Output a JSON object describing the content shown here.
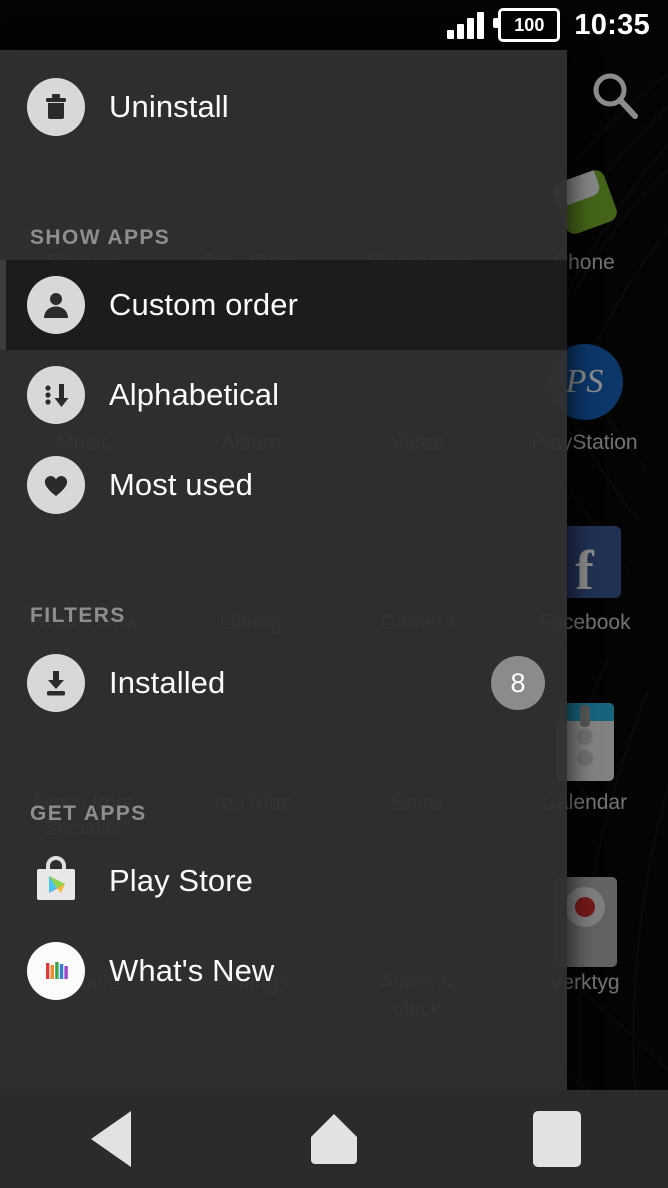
{
  "status_bar": {
    "signal_icon": "signal-bars-icon",
    "battery_level": "100",
    "time": "10:35"
  },
  "app_drawer": {
    "title": "Custom order",
    "search_icon": "search-icon",
    "apps": [
      {
        "label": "Chrome",
        "icon": "chrome-icon"
      },
      {
        "label": "Play Store",
        "icon": "play-store-icon"
      },
      {
        "label": "Messaging",
        "icon": "messaging-icon"
      },
      {
        "label": "Phone",
        "icon": "phone-icon"
      },
      {
        "label": "Music",
        "icon": "music-icon"
      },
      {
        "label": "Album",
        "icon": "album-icon"
      },
      {
        "label": "Video",
        "icon": "video-icon"
      },
      {
        "label": "PlayStation",
        "icon": "playstation-icon"
      },
      {
        "label": "What's New",
        "icon": "whats-new-icon"
      },
      {
        "label": "Lifelog",
        "icon": "lifelog-icon"
      },
      {
        "label": "Camera",
        "icon": "camera-icon"
      },
      {
        "label": "Facebook",
        "icon": "facebook-icon"
      },
      {
        "label": "News from\nSocialife",
        "icon": "socialife-icon"
      },
      {
        "label": "YouTube",
        "icon": "youtube-icon"
      },
      {
        "label": "Email",
        "icon": "email-icon"
      },
      {
        "label": "Calendar",
        "icon": "calendar-icon"
      },
      {
        "label": "Contacts",
        "icon": "contacts-icon"
      },
      {
        "label": "Settings",
        "icon": "settings-icon"
      },
      {
        "label": "Alarm &\nclock",
        "icon": "alarm-clock-icon"
      },
      {
        "label": "Verktyg",
        "icon": "verktyg-icon"
      }
    ]
  },
  "nav_drawer": {
    "uninstall": {
      "label": "Uninstall",
      "icon": "trash-icon"
    },
    "sections": [
      {
        "header": "SHOW APPS",
        "items": [
          {
            "label": "Custom order",
            "icon": "person-icon",
            "selected": true
          },
          {
            "label": "Alphabetical",
            "icon": "sort-alphabetical-icon",
            "selected": false
          },
          {
            "label": "Most used",
            "icon": "heart-icon",
            "selected": false
          }
        ]
      },
      {
        "header": "FILTERS",
        "items": [
          {
            "label": "Installed",
            "icon": "download-icon",
            "selected": false,
            "badge": "8"
          }
        ]
      },
      {
        "header": "GET APPS",
        "items": [
          {
            "label": "Play Store",
            "icon": "play-store-bag-icon",
            "selected": false
          },
          {
            "label": "What's New",
            "icon": "whats-new-bars-icon",
            "selected": false
          }
        ]
      }
    ]
  },
  "system_nav": {
    "back": "back-button",
    "home": "home-button",
    "recents": "recents-button"
  },
  "colors": {
    "drawer_bg": "#303030",
    "selected_row": "#1c1c1c",
    "section_header": "#8e8e8e",
    "icon_circle": "#d8d8d8",
    "badge": "#8b8b8b",
    "navbar": "#2b2b2b",
    "accent_green": "#7cb82f",
    "facebook_blue": "#3b5998",
    "playstation_blue": "#1565c0",
    "calendar_blue": "#29b6e6"
  }
}
